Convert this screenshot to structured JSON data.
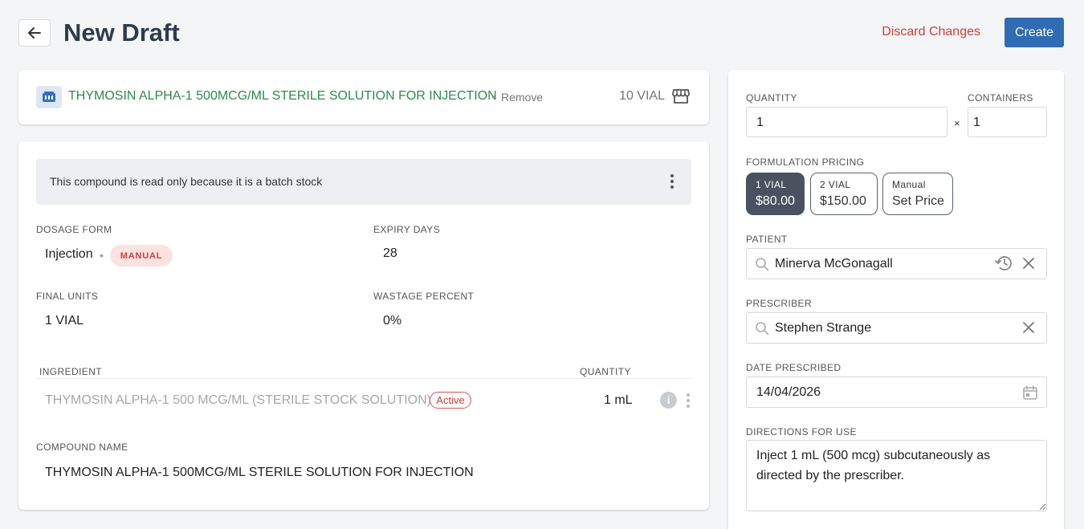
{
  "header": {
    "title": "New Draft",
    "discard_label": "Discard Changes",
    "create_label": "Create"
  },
  "product": {
    "name": "THYMOSIN ALPHA-1 500MCG/ML STERILE SOLUTION FOR INJECTION",
    "separator": "•",
    "remove_label": "Remove",
    "quantity": "10 VIAL",
    "icon": "store-icon"
  },
  "details": {
    "banner_text": "This compound is read only because it is a batch stock",
    "dosage_form_label": "DOSAGE FORM",
    "dosage_form_value": "Injection",
    "dosage_badge": "MANUAL",
    "expiry_days_label": "EXPIRY DAYS",
    "expiry_days_value": "28",
    "final_units_label": "FINAL UNITS",
    "final_units_value": "1 VIAL",
    "wastage_label": "WASTAGE PERCENT",
    "wastage_value": "0%",
    "ingredient_header": "INGREDIENT",
    "quantity_header": "QUANTITY",
    "ingredients": [
      {
        "name": "THYMOSIN ALPHA-1 500 MCG/ML (STERILE STOCK SOLUTION)",
        "status": "Active",
        "quantity": "1 mL"
      }
    ],
    "compound_name_label": "COMPOUND NAME",
    "compound_name_value": "THYMOSIN ALPHA-1 500MCG/ML STERILE SOLUTION FOR INJECTION"
  },
  "sidebar": {
    "quantity_label": "QUANTITY",
    "quantity_value": "1",
    "times_symbol": "×",
    "containers_label": "CONTAINERS",
    "containers_value": "1",
    "pricing_label": "FORMULATION PRICING",
    "pricing_options": [
      {
        "small": "1 VIAL",
        "big": "$80.00",
        "selected": true
      },
      {
        "small": "2 VIAL",
        "big": "$150.00",
        "selected": false
      },
      {
        "small": "Manual",
        "big": "Set Price",
        "selected": false
      }
    ],
    "patient_label": "PATIENT",
    "patient_value": "Minerva McGonagall",
    "prescriber_label": "PRESCRIBER",
    "prescriber_value": "Stephen Strange",
    "date_label": "DATE PRESCRIBED",
    "date_value": "14/04/2026",
    "directions_label": "DIRECTIONS FOR USE",
    "directions_value": "Inject 1 mL (500 mcg) subcutaneously as directed by the prescriber."
  },
  "colors": {
    "accent": "#2f6cb3",
    "danger": "#c8413a",
    "product_green": "#2e8a4e",
    "selected_price": "#4a5260"
  }
}
